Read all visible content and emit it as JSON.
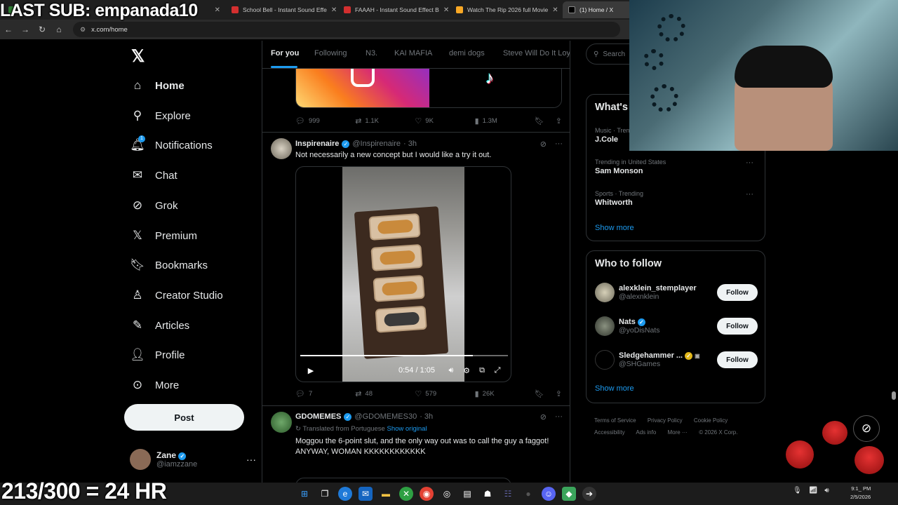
{
  "browser": {
    "tabs": [
      {
        "label": "",
        "favicon_color": "#2e7d32"
      },
      {
        "label": "School Bell - Instant Sound Effe",
        "favicon_color": "#d32f2f"
      },
      {
        "label": "FAAAH - Instant Sound Effect B",
        "favicon_color": "#d32f2f"
      },
      {
        "label": "Watch The Rip 2026 full Movie",
        "favicon_color": "#f9a825"
      },
      {
        "label": "(1) Home / X",
        "favicon_color": "#000000"
      }
    ],
    "url": "x.com/home"
  },
  "overlay": {
    "last_sub": "LAST SUB: empanada10",
    "sub_goal": "213/300 = 24 HR"
  },
  "sidebar": {
    "logo": "𝕏",
    "items": [
      {
        "label": "Home",
        "icon": "home-icon",
        "glyph": "⌂"
      },
      {
        "label": "Explore",
        "icon": "search-icon",
        "glyph": "⚲"
      },
      {
        "label": "Notifications",
        "icon": "bell-icon",
        "glyph": "🔔︎"
      },
      {
        "label": "Chat",
        "icon": "mail-icon",
        "glyph": "✉"
      },
      {
        "label": "Grok",
        "icon": "grok-icon",
        "glyph": "⊘"
      },
      {
        "label": "Premium",
        "icon": "x-icon",
        "glyph": "𝕏"
      },
      {
        "label": "Bookmarks",
        "icon": "bookmark-icon",
        "glyph": "🔖︎"
      },
      {
        "label": "Creator Studio",
        "icon": "creator-icon",
        "glyph": "♙"
      },
      {
        "label": "Articles",
        "icon": "articles-icon",
        "glyph": "✎"
      },
      {
        "label": "Profile",
        "icon": "person-icon",
        "glyph": "👤︎"
      },
      {
        "label": "More",
        "icon": "more-circle-icon",
        "glyph": "⊙"
      }
    ],
    "notif_count": "1",
    "post_label": "Post",
    "account": {
      "name": "Zane",
      "handle": "@iamzzane",
      "more": "···"
    }
  },
  "feed": {
    "tabs": [
      "For you",
      "Following",
      "N3.",
      "KAI MAFIA",
      "demi dogs",
      "Steve Will Do It Loy"
    ],
    "post1_actions": {
      "replies": "999",
      "reposts": "1.1K",
      "likes": "9K",
      "views": "1.3M"
    },
    "post2": {
      "name": "Inspirenaire",
      "handle": "@Inspirenaire",
      "time": "· 3h",
      "text": "Not necessarily a new concept but I would like a try it out.",
      "video_time": "0:54 / 1:05",
      "video_progress": 0.83,
      "actions": {
        "replies": "7",
        "reposts": "48",
        "likes": "579",
        "views": "26K"
      }
    },
    "post3": {
      "name": "GDOMEMES",
      "handle": "@GDOMEMES30",
      "time": "· 3h",
      "translated": "Translated from Portuguese",
      "show_original": "Show original",
      "line1": "Moggou the 6-point slut, and the only way out was to call the guy a faggot!",
      "line2": "ANYWAY, WOMAN KKKKKKKKKKKK"
    }
  },
  "right": {
    "search_placeholder": "Search",
    "whats_happening": "What's happening",
    "trends": [
      {
        "meta": "Music · Trending",
        "topic": "J.Cole"
      },
      {
        "meta": "Trending in United States",
        "topic": "Sam Monson"
      },
      {
        "meta": "Sports · Trending",
        "topic": "Whitworth"
      }
    ],
    "show_more": "Show more",
    "who_to_follow": "Who to follow",
    "suggestions": [
      {
        "name": "alexklein_stemplayer",
        "handle": "@alexnklein",
        "follow": "Follow"
      },
      {
        "name": "Nats",
        "handle": "@yoDisNats",
        "follow": "Follow"
      },
      {
        "name": "Sledgehammer ...",
        "handle": "@SHGames",
        "follow": "Follow"
      }
    ],
    "footer": [
      "Terms of Service",
      "Privacy Policy",
      "Cookie Policy",
      "Accessibility",
      "Ads info",
      "More ···",
      "© 2026 X Corp."
    ]
  },
  "taskbar": {
    "time": "9:1_ PM",
    "date": "2/5/2026"
  }
}
